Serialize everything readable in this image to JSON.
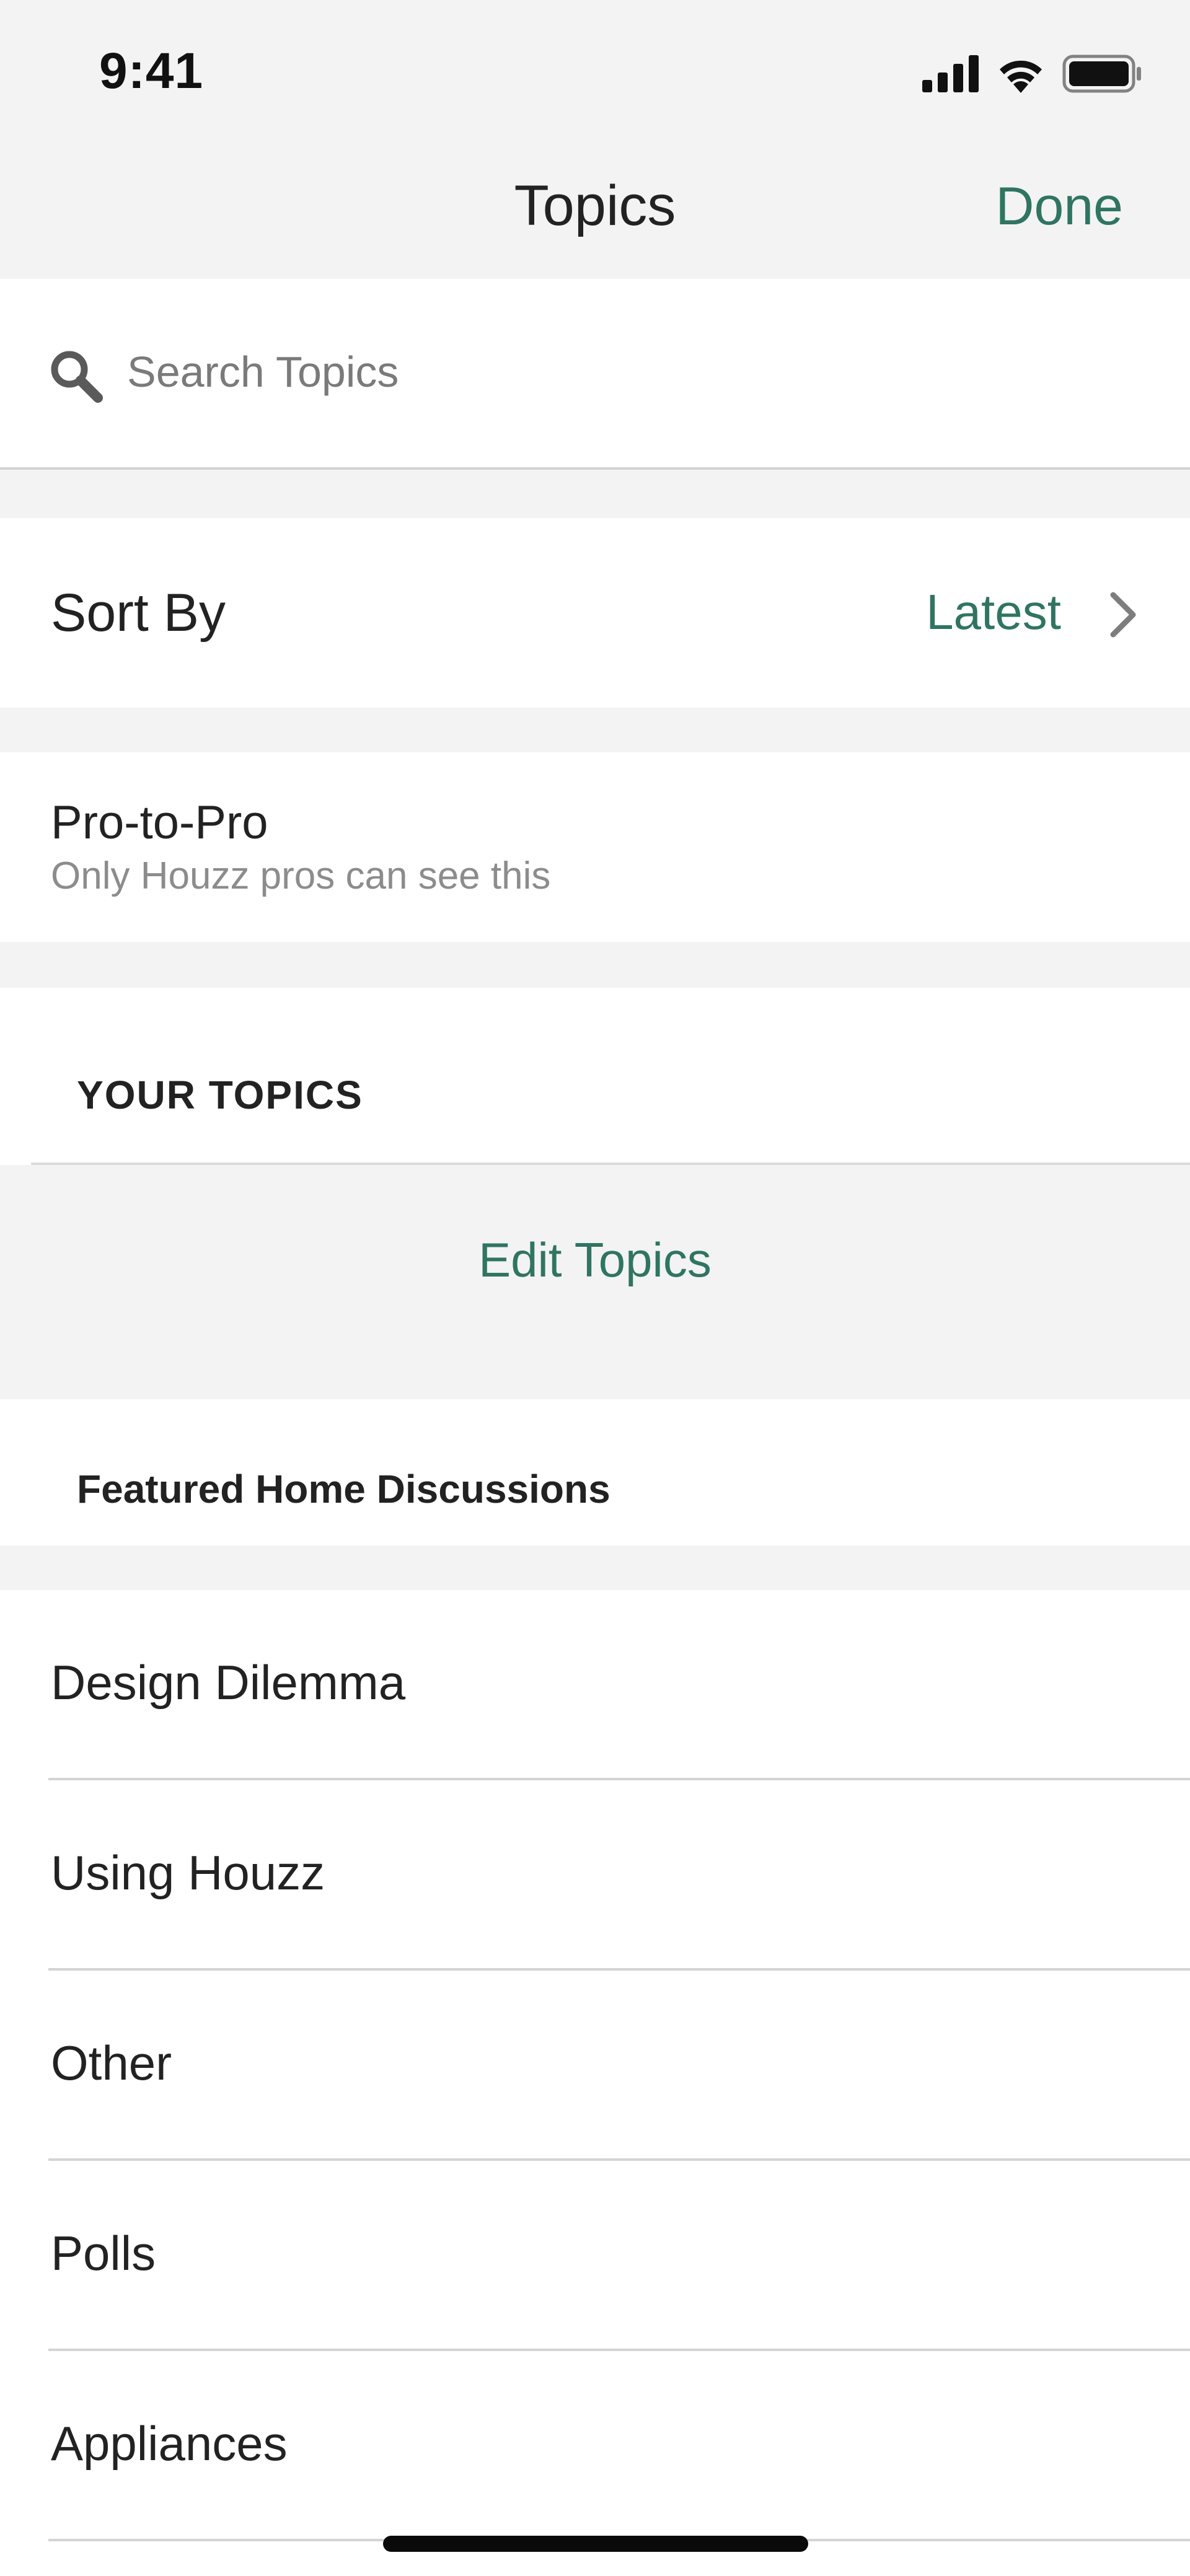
{
  "status_bar": {
    "time": "9:41",
    "icons": [
      "signal-icon",
      "wifi-icon",
      "battery-icon"
    ]
  },
  "nav": {
    "title": "Topics",
    "done_label": "Done"
  },
  "search": {
    "placeholder": "Search Topics",
    "value": ""
  },
  "sort": {
    "label": "Sort By",
    "value": "Latest"
  },
  "pro": {
    "title": "Pro-to-Pro",
    "subtitle": "Only Houzz pros can see this"
  },
  "your_topics": {
    "heading": "YOUR TOPICS",
    "edit_label": "Edit Topics"
  },
  "featured": {
    "heading": "Featured Home Discussions",
    "items": [
      {
        "label": "Design Dilemma"
      },
      {
        "label": "Using Houzz"
      },
      {
        "label": "Other"
      },
      {
        "label": "Polls"
      },
      {
        "label": "Appliances"
      }
    ]
  },
  "colors": {
    "accent": "#2f7561",
    "background": "#f3f3f3",
    "row_background": "#ffffff",
    "secondary_text": "#8c8c8c"
  }
}
